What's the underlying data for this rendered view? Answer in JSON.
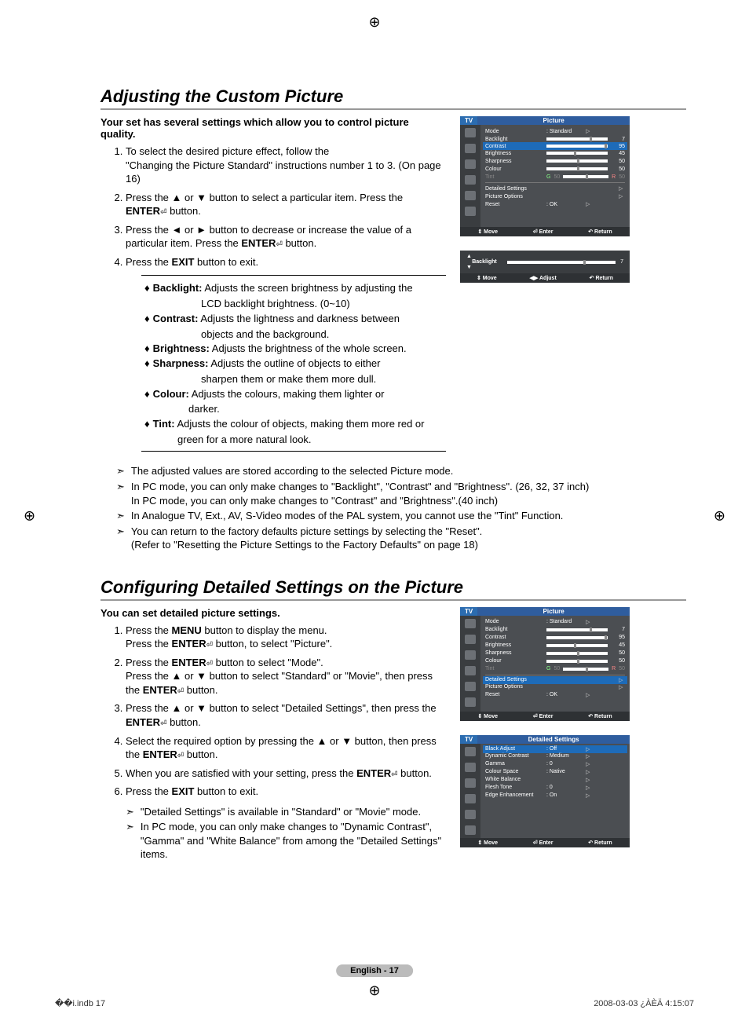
{
  "page": {
    "section1_title": "Adjusting the Custom Picture",
    "section1_intro": "Your set has several settings which allow you to control picture quality.",
    "section2_title": "Configuring Detailed Settings on the Picture",
    "section2_intro": "You can set detailed picture settings.",
    "footer_page": "English - 17",
    "footer_left": "��i.indb   17",
    "footer_right": "2008-03-03   ¿ÀÈÄ 4:15:07"
  },
  "steps1": {
    "s1a": "To select the desired picture effect, follow the",
    "s1b": "\"Changing the Picture Standard\" instructions number 1 to 3. (On page 16)",
    "s2a": "Press the ▲ or ▼ button to select a particular item. Press the ",
    "s2b": "ENTER",
    "s2c": " button.",
    "s3a": "Press the ◄ or ► button to decrease or increase the value of a particular item. Press the ",
    "s3b": "ENTER",
    "s3c": " button.",
    "s4a": "Press the ",
    "s4b": "EXIT",
    "s4c": " button to exit."
  },
  "defs": {
    "backlight_t": "Backlight:",
    "backlight_d": " Adjusts the screen brightness by adjusting the",
    "backlight_d2": "LCD backlight brightness. (0~10)",
    "contrast_t": "Contrast:",
    "contrast_d": " Adjusts the lightness and darkness between",
    "contrast_d2": "objects and the background.",
    "brightness_t": "Brightness:",
    "brightness_d": " Adjusts the brightness of the whole screen.",
    "sharpness_t": "Sharpness:",
    "sharpness_d": " Adjusts the outline of objects to either",
    "sharpness_d2": "sharpen them or make them more dull.",
    "colour_t": "Colour:",
    "colour_d": " Adjusts the colours, making them lighter or",
    "colour_d2": "darker.",
    "tint_t": "Tint:",
    "tint_d": " Adjusts the colour of objects, making them more red or",
    "tint_d2": "green for a more natural look."
  },
  "notes1": {
    "n1": "The adjusted values are stored according to the selected Picture mode.",
    "n2a": "In PC mode, you can only make changes to \"Backlight\", \"Contrast\" and \"Brightness\". (26, 32, 37 inch)",
    "n2b": "In PC mode, you can only make changes to \"Contrast\" and \"Brightness\".(40 inch)",
    "n3": "In Analogue TV, Ext., AV, S-Video modes of the PAL system, you cannot use the \"Tint\" Function.",
    "n4a": "You can return to the factory defaults picture settings by selecting the \"Reset\".",
    "n4b": "(Refer to \"Resetting the Picture Settings to the Factory Defaults\" on page 18)"
  },
  "steps2": {
    "s1a": "Press the ",
    "s1b": "MENU",
    "s1c": " button to display the menu.",
    "s1d": "Press the ",
    "s1e": "ENTER",
    "s1f": " button, to select \"Picture\".",
    "s2a": "Press the ",
    "s2b": "ENTER",
    "s2c": " button to select \"Mode\".",
    "s2d": "Press the ▲ or ▼ button to select \"Standard\" or \"Movie\", then press the ",
    "s2e": "ENTER",
    "s2f": " button.",
    "s3a": "Press the ▲ or ▼ button to select \"Detailed Settings\", then press the ",
    "s3b": "ENTER",
    "s3c": " button.",
    "s4a": "Select the required option by pressing the ▲ or ▼ button, then press the ",
    "s4b": "ENTER",
    "s4c": " button.",
    "s5a": "When you are satisfied with your setting, press the ",
    "s5b": "ENTER",
    "s5c": " button.",
    "s6a": "Press the ",
    "s6b": "EXIT",
    "s6c": " button to exit.",
    "n1": "\"Detailed Settings\" is available in \"Standard\" or \"Movie\" mode.",
    "n2": "In PC mode, you can only make changes to \"Dynamic Contrast\", \"Gamma\" and \"White Balance\" from among the \"Detailed Settings\" items."
  },
  "osd": {
    "tv": "TV",
    "picture": "Picture",
    "mode": "Mode",
    "mode_val": ": Standard",
    "backlight": "Backlight",
    "backlight_val": "7",
    "contrast": "Contrast",
    "contrast_val": "95",
    "brightness": "Brightness",
    "brightness_val": "45",
    "sharpness": "Sharpness",
    "sharpness_val": "50",
    "colour": "Colour",
    "colour_val": "50",
    "tint": "Tint",
    "tint_g": "G",
    "tint_50": "50",
    "tint_r": "R",
    "tint_r50": "50",
    "detailed": "Detailed Settings",
    "picopt": "Picture Options",
    "reset": "Reset",
    "reset_val": ": OK",
    "move": "Move",
    "enter": "Enter",
    "return": "Return",
    "adjust": "Adjust",
    "blacklevel": "Black Adjust",
    "blacklevel_v": ": Off",
    "dyncon": "Dynamic Contrast",
    "dyncon_v": ": Medium",
    "gamma": "Gamma",
    "gamma_v": ":   0",
    "cspace": "Colour Space",
    "cspace_v": ": Native",
    "wbal": "White Balance",
    "flesh": "Flesh Tone",
    "flesh_v": ":   0",
    "edge": "Edge Enhancement",
    "edge_v": ": On"
  }
}
